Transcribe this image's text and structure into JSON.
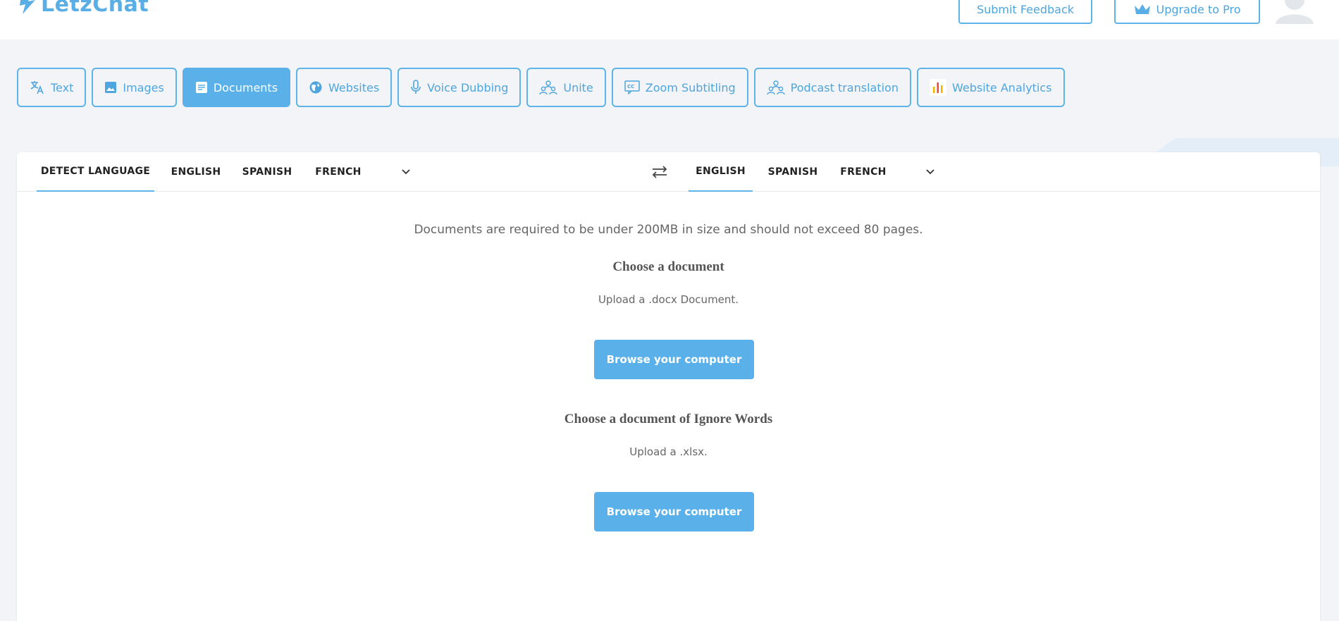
{
  "header": {
    "logo_text": "LetzChat",
    "feedback_label": "Submit Feedback",
    "upgrade_label": "Upgrade to Pro"
  },
  "tabs": [
    {
      "label": "Text",
      "icon": "translate-icon"
    },
    {
      "label": "Images",
      "icon": "image-icon"
    },
    {
      "label": "Documents",
      "icon": "document-icon",
      "active": true
    },
    {
      "label": "Websites",
      "icon": "globe-icon"
    },
    {
      "label": "Voice Dubbing",
      "icon": "microphone-icon"
    },
    {
      "label": "Unite",
      "icon": "group-icon"
    },
    {
      "label": "Zoom Subtitling",
      "icon": "subtitles-icon"
    },
    {
      "label": "Podcast translation",
      "icon": "group-icon"
    },
    {
      "label": "Website Analytics",
      "icon": "bar-chart-icon"
    }
  ],
  "source_languages": [
    "DETECT LANGUAGE",
    "ENGLISH",
    "SPANISH",
    "FRENCH"
  ],
  "target_languages": [
    "ENGLISH",
    "SPANISH",
    "FRENCH"
  ],
  "content": {
    "requirement": "Documents are required to be under 200MB in size and should not exceed 80 pages.",
    "doc_title": "Choose a document",
    "doc_hint": "Upload a .docx Document.",
    "browse_label": "Browse your computer",
    "ignore_title": "Choose a document of Ignore Words",
    "ignore_hint": "Upload a .xlsx.",
    "browse_label_2": "Browse your computer"
  },
  "colors": {
    "accent": "#5ab1ea",
    "background": "#f2f4f7"
  }
}
